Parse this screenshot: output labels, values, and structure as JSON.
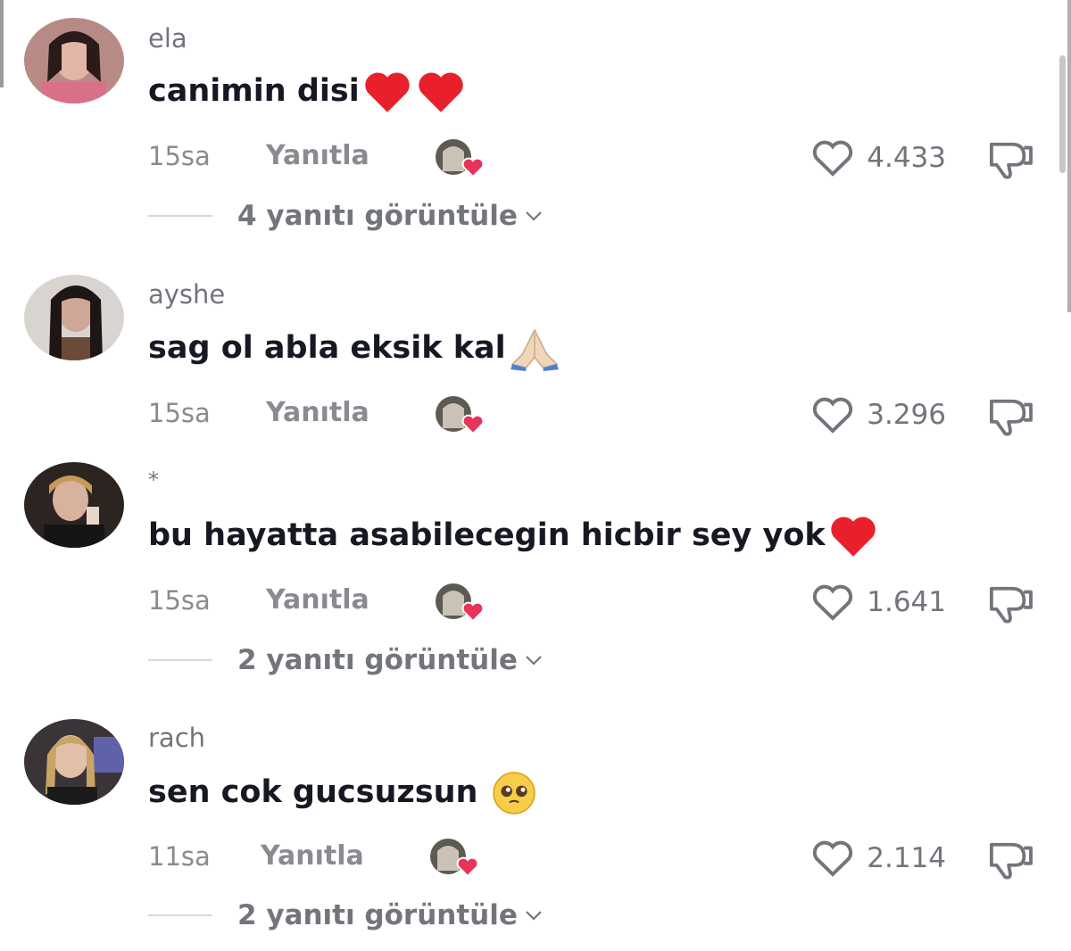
{
  "comments": [
    {
      "username": "ela",
      "text": "canimin disi",
      "emoji": [
        "heart",
        "heart"
      ],
      "time": "15sa",
      "reply_label": "Yanıtla",
      "likes": "4.433",
      "view_replies": "4 yanıtı görüntüle"
    },
    {
      "username": "ayshe",
      "text": "sag ol abla eksik kal",
      "emoji": [
        "praying-hands"
      ],
      "time": "15sa",
      "reply_label": "Yanıtla",
      "likes": "3.296",
      "view_replies": ""
    },
    {
      "username": "*",
      "text": "bu hayatta asabilecegin hicbir sey yok",
      "emoji": [
        "heart"
      ],
      "time": "15sa",
      "reply_label": "Yanıtla",
      "likes": "1.641",
      "view_replies": "2 yanıtı görüntüle"
    },
    {
      "username": "rach",
      "text": "sen cok gucsuzsun ",
      "emoji": [
        "pleading-face"
      ],
      "time": "11sa",
      "reply_label": "Yanıtla",
      "likes": "2.114",
      "view_replies": "2 yanıtı görüntüle"
    }
  ],
  "icons": {
    "like": "heart-outline-icon",
    "dislike": "thumbs-down-icon",
    "creator_liked": "creator-liked-badge-icon",
    "chevron": "chevron-down-icon"
  },
  "colors": {
    "heart_red": "#e8202b",
    "muted_text": "#73757c"
  }
}
